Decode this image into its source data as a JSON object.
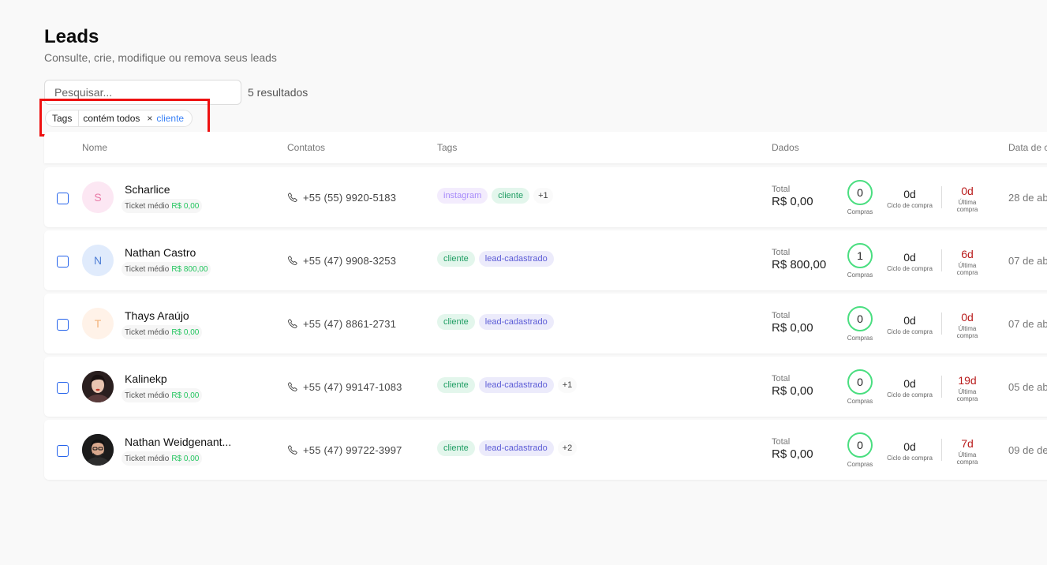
{
  "page": {
    "title": "Leads",
    "subtitle": "Consulte, crie, modifique ou remova seus leads"
  },
  "search": {
    "placeholder": "Pesquisar...",
    "value": ""
  },
  "result_count": "5 resultados",
  "filter": {
    "key": "Tags",
    "operator": "contém todos",
    "remove": "×",
    "value": "cliente"
  },
  "table": {
    "columns": {
      "nome": "Nome",
      "contatos": "Contatos",
      "tags": "Tags",
      "dados": "Dados",
      "data": "Data de c"
    },
    "labels": {
      "ticket": "Ticket médio",
      "total": "Total",
      "compras": "Compras",
      "ciclo": "Ciclo de compra",
      "ultima1": "Última",
      "ultima2": "compra"
    },
    "rows": [
      {
        "name": "Scharlice",
        "initial": "S",
        "avatar_bg": "#fce7f3",
        "avatar_fg": "#e879a6",
        "ticket": "R$ 0,00",
        "phone": "+55 (55) 9920-5183",
        "tags": [
          "instagram",
          "cliente"
        ],
        "more": "+1",
        "total": "R$ 0,00",
        "compras": "0",
        "ciclo": "0d",
        "ultima": "0d",
        "date": "28 de ab"
      },
      {
        "name": "Nathan Castro",
        "initial": "N",
        "avatar_bg": "#e0ebfc",
        "avatar_fg": "#4f7fd6",
        "ticket": "R$ 800,00",
        "phone": "+55 (47) 9908-3253",
        "tags": [
          "cliente",
          "lead-cadastrado"
        ],
        "more": "",
        "total": "R$ 800,00",
        "compras": "1",
        "ciclo": "0d",
        "ultima": "6d",
        "date": "07 de ab"
      },
      {
        "name": "Thays Araújo",
        "initial": "T",
        "avatar_bg": "#fff2e8",
        "avatar_fg": "#f2b27a",
        "ticket": "R$ 0,00",
        "phone": "+55 (47) 8861-2731",
        "tags": [
          "cliente",
          "lead-cadastrado"
        ],
        "more": "",
        "total": "R$ 0,00",
        "compras": "0",
        "ciclo": "0d",
        "ultima": "0d",
        "date": "07 de ab"
      },
      {
        "name": "Kalinekp",
        "initial": "",
        "avatar_bg": "#3b2a2a",
        "avatar_fg": "#ffffff",
        "ticket": "R$ 0,00",
        "phone": "+55 (47) 99147-1083",
        "tags": [
          "cliente",
          "lead-cadastrado"
        ],
        "more": "+1",
        "total": "R$ 0,00",
        "compras": "0",
        "ciclo": "0d",
        "ultima": "19d",
        "date": "05 de ab"
      },
      {
        "name": "Nathan Weidgenant...",
        "initial": "",
        "avatar_bg": "#1f2937",
        "avatar_fg": "#ffffff",
        "ticket": "R$ 0,00",
        "phone": "+55 (47) 99722-3997",
        "tags": [
          "cliente",
          "lead-cadastrado"
        ],
        "more": "+2",
        "total": "R$ 0,00",
        "compras": "0",
        "ciclo": "0d",
        "ultima": "7d",
        "date": "09 de de"
      }
    ]
  },
  "colors": {
    "accent": "#2563eb",
    "highlight": "#ee1111",
    "positive": "#22c55e",
    "alert": "#b91c1c"
  },
  "icons": {
    "phone": "phone-icon",
    "remove": "close-icon",
    "photo": "avatar-photo"
  }
}
